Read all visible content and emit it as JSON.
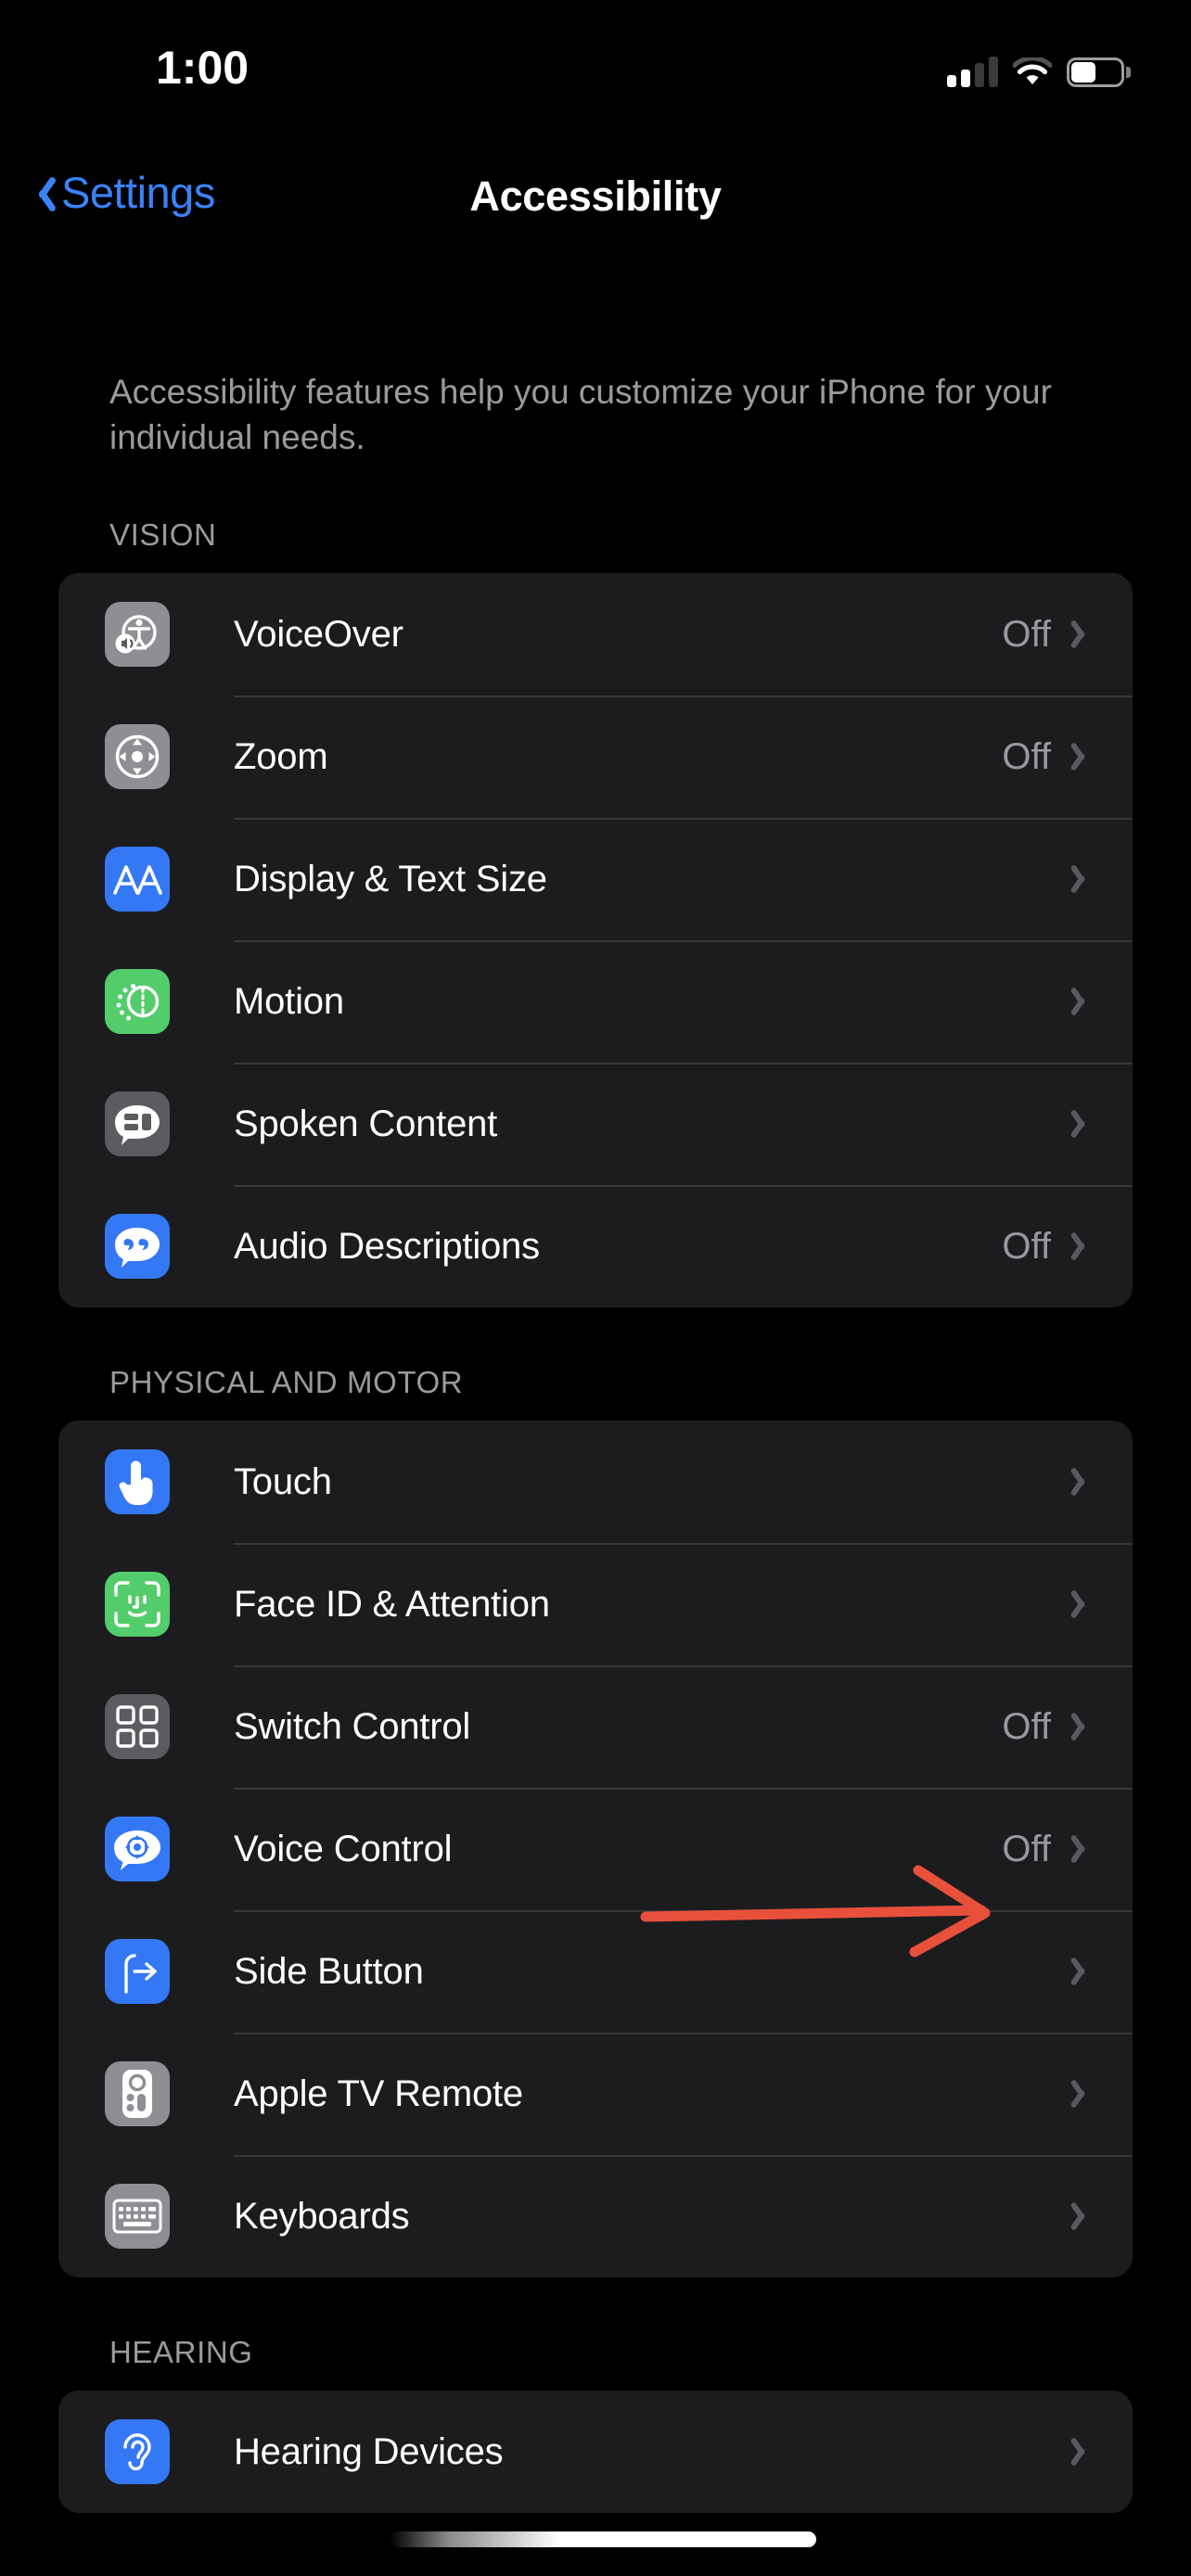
{
  "status_bar": {
    "time": "1:00",
    "signal_icon": "cellular-signal-icon",
    "signal_bars_filled": 2,
    "signal_bars_total": 4,
    "wifi_icon": "wifi-icon",
    "battery_icon": "battery-icon",
    "battery_level_percent": 50
  },
  "nav": {
    "back_label": "Settings",
    "back_icon": "chevron-left-icon",
    "title": "Accessibility"
  },
  "intro": "Accessibility features help you customize your iPhone for your individual needs.",
  "sections": [
    {
      "header": "VISION",
      "rows": [
        {
          "label": "VoiceOver",
          "value": "Off",
          "icon": "voiceover-icon",
          "icon_color": "#8E8E93"
        },
        {
          "label": "Zoom",
          "value": "Off",
          "icon": "zoom-icon",
          "icon_color": "#8E8E93"
        },
        {
          "label": "Display & Text Size",
          "value": "",
          "icon": "display-text-size-icon",
          "icon_color": "#3478F6"
        },
        {
          "label": "Motion",
          "value": "",
          "icon": "motion-icon",
          "icon_color": "#53CC6C"
        },
        {
          "label": "Spoken Content",
          "value": "",
          "icon": "spoken-content-icon",
          "icon_color": "#5B5B60"
        },
        {
          "label": "Audio Descriptions",
          "value": "Off",
          "icon": "audio-descriptions-icon",
          "icon_color": "#3478F6"
        }
      ]
    },
    {
      "header": "PHYSICAL AND MOTOR",
      "rows": [
        {
          "label": "Touch",
          "value": "",
          "icon": "touch-icon",
          "icon_color": "#3478F6"
        },
        {
          "label": "Face ID & Attention",
          "value": "",
          "icon": "face-id-icon",
          "icon_color": "#53CC6C"
        },
        {
          "label": "Switch Control",
          "value": "Off",
          "icon": "switch-control-icon",
          "icon_color": "#5B5B60"
        },
        {
          "label": "Voice Control",
          "value": "Off",
          "icon": "voice-control-icon",
          "icon_color": "#3478F6"
        },
        {
          "label": "Side Button",
          "value": "",
          "icon": "side-button-icon",
          "icon_color": "#3478F6"
        },
        {
          "label": "Apple TV Remote",
          "value": "",
          "icon": "apple-tv-remote-icon",
          "icon_color": "#8E8E93"
        },
        {
          "label": "Keyboards",
          "value": "",
          "icon": "keyboards-icon",
          "icon_color": "#8E8E93"
        }
      ]
    },
    {
      "header": "HEARING",
      "rows": [
        {
          "label": "Hearing Devices",
          "value": "",
          "icon": "hearing-devices-icon",
          "icon_color": "#3478F6"
        }
      ]
    }
  ],
  "annotation": {
    "type": "arrow",
    "name": "red-annotation-arrow",
    "color": "#E8503C",
    "points_at": "Voice Control"
  },
  "home_indicator": {
    "icon": "home-indicator"
  },
  "colors": {
    "background": "#000000",
    "card": "#1C1C1E",
    "separator": "#38383A",
    "accent_blue": "#3B82F7",
    "secondary_text": "#9B9B9F",
    "value_text": "#98989E"
  }
}
